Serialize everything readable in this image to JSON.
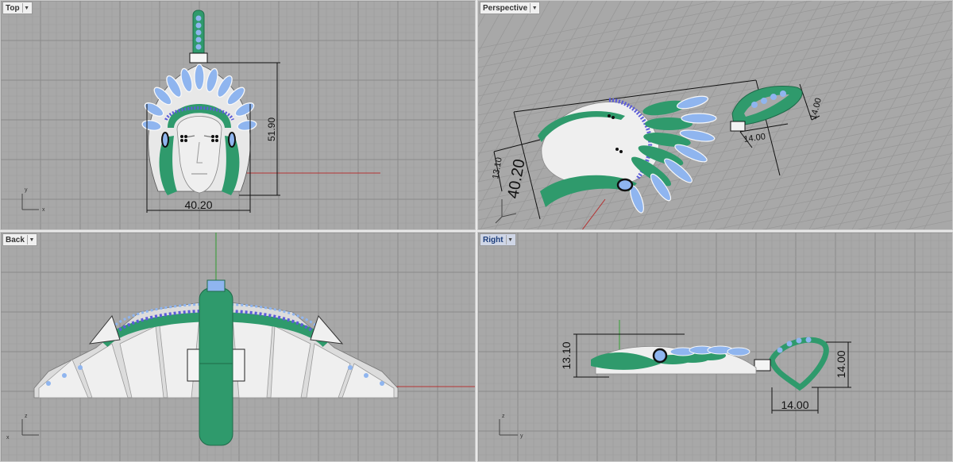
{
  "viewports": {
    "top": {
      "label": "Top",
      "dim_width": "40.20",
      "dim_height": "51.90"
    },
    "perspective": {
      "label": "Perspective",
      "dim_width": "40.20",
      "dim_depth": "13.10",
      "dim_loop_w": "14.00",
      "dim_loop_h": "14.00"
    },
    "back": {
      "label": "Back"
    },
    "right": {
      "label": "Right",
      "dim_depth": "13.10",
      "dim_loop_h": "14.00",
      "dim_loop_w": "14.00"
    }
  },
  "axes": {
    "x": "x",
    "y": "y",
    "z": "z"
  },
  "colors": {
    "viewport_bg": "#a8a8a8",
    "grid_minor": "#9b9b9b",
    "grid_major": "#8a8a8a",
    "model_green": "#2f9a6c",
    "gem_blue": "#8fb5ef",
    "metal_white": "#efefef",
    "axis_red": "#b33333",
    "axis_green": "#33a033"
  },
  "icons": [
    "viewport-menu-chevron-icon",
    "axis-gizmo-icon"
  ]
}
